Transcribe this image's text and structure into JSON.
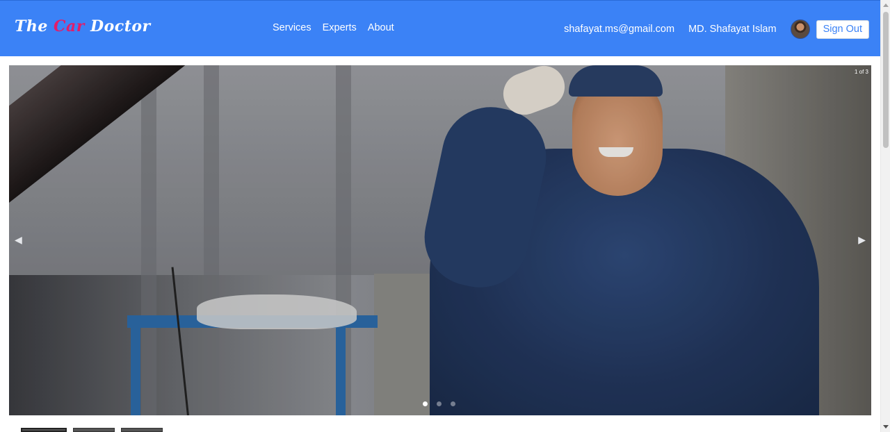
{
  "brand": {
    "part1": "The ",
    "accent": "Car",
    "part2": " Doctor",
    "accent_color": "#e11d6a"
  },
  "nav": {
    "links": [
      {
        "label": "Services"
      },
      {
        "label": "Experts"
      },
      {
        "label": "About"
      }
    ]
  },
  "user": {
    "email": "shafayat.ms@gmail.com",
    "name": "MD. Shafayat Islam",
    "signout_label": "Sign Out"
  },
  "carousel": {
    "counter": "1 of 3",
    "prev_icon": "chevron-left-icon",
    "next_icon": "chevron-right-icon",
    "prev_glyph": "◀",
    "next_glyph": "▶",
    "slide_count": 3,
    "active_slide": 1
  },
  "colors": {
    "navbar": "#3b82f6",
    "signout_text": "#3b82f6"
  }
}
